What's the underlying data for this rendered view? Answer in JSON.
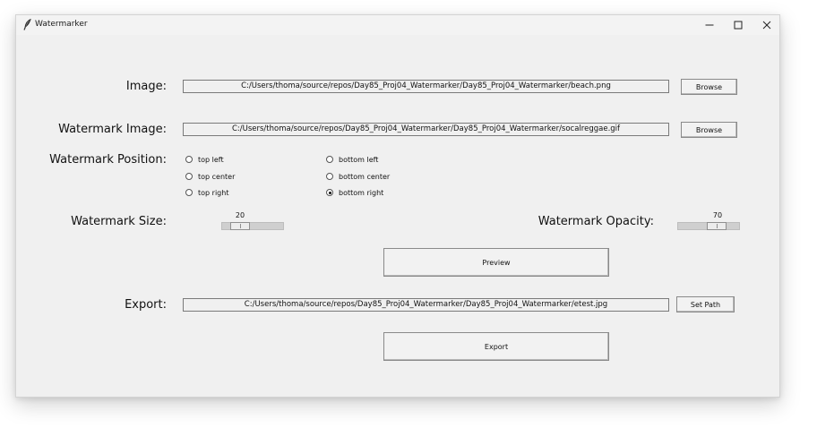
{
  "window": {
    "title": "Watermarker"
  },
  "form": {
    "image_label": "Image:",
    "image_path": "C:/Users/thoma/source/repos/Day85_Proj04_Watermarker/Day85_Proj04_Watermarker/beach.png",
    "image_browse": "Browse",
    "watermark_label": "Watermark Image:",
    "watermark_path": "C:/Users/thoma/source/repos/Day85_Proj04_Watermarker/Day85_Proj04_Watermarker/socalreggae.gif",
    "watermark_browse": "Browse",
    "position_label": "Watermark Position:",
    "positions": [
      {
        "label": "top left",
        "selected": false
      },
      {
        "label": "top center",
        "selected": false
      },
      {
        "label": "top right",
        "selected": false
      },
      {
        "label": "bottom left",
        "selected": false
      },
      {
        "label": "bottom center",
        "selected": false
      },
      {
        "label": "bottom right",
        "selected": true
      }
    ],
    "size_label": "Watermark Size:",
    "size_value": "20",
    "size_fraction": 0.2,
    "opacity_label": "Watermark Opacity:",
    "opacity_value": "70",
    "opacity_fraction": 0.7,
    "preview_button": "Preview",
    "export_label": "Export:",
    "export_path": "C:/Users/thoma/source/repos/Day85_Proj04_Watermarker/Day85_Proj04_Watermarker/etest.jpg",
    "set_path_button": "Set Path",
    "export_button": "Export"
  },
  "icons": {
    "app": "feather-icon",
    "minimize": "minimize-icon",
    "maximize": "maximize-icon",
    "close": "close-icon"
  }
}
